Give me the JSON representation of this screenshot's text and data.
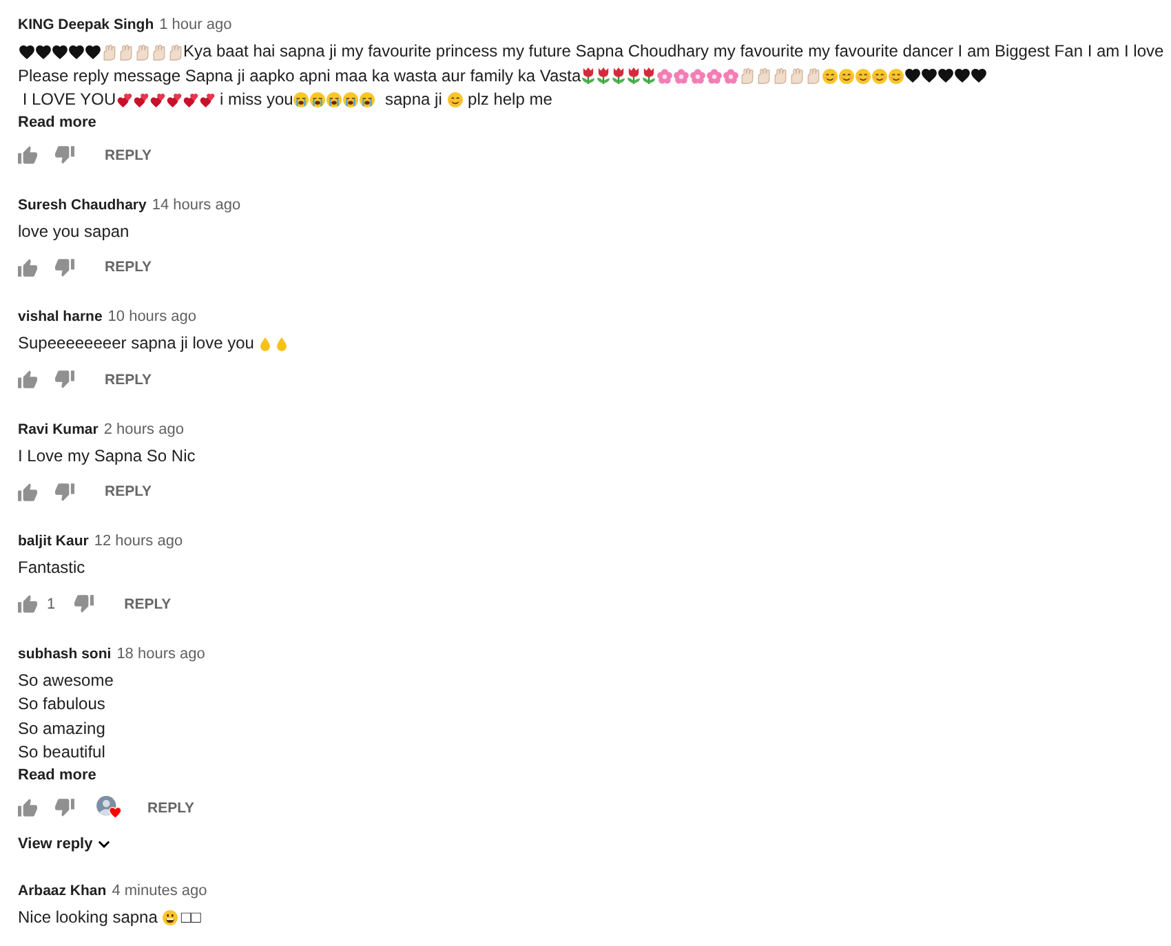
{
  "comments": [
    {
      "author": "KING Deepak Singh",
      "time": "1 hour ago",
      "lines": [
        [
          {
            "kind": "heart"
          },
          {
            "kind": "heart"
          },
          {
            "kind": "heart"
          },
          {
            "kind": "heart"
          },
          {
            "kind": "heart"
          },
          {
            "kind": "hand"
          },
          {
            "kind": "hand"
          },
          {
            "kind": "hand"
          },
          {
            "kind": "hand"
          },
          {
            "kind": "hand"
          },
          {
            "kind": "text",
            "text": "Kya baat hai sapna ji my favourite princess my future Sapna Choudhary my favourite my favourite dancer I am Biggest Fan I am I love"
          }
        ],
        [
          {
            "kind": "text",
            "text": "Please reply message Sapna ji aapko apni maa ka wasta aur family ka Vasta"
          },
          {
            "kind": "tulip"
          },
          {
            "kind": "tulip"
          },
          {
            "kind": "tulip"
          },
          {
            "kind": "tulip"
          },
          {
            "kind": "tulip"
          },
          {
            "kind": "blossom"
          },
          {
            "kind": "blossom"
          },
          {
            "kind": "blossom"
          },
          {
            "kind": "blossom"
          },
          {
            "kind": "blossom"
          },
          {
            "kind": "hand"
          },
          {
            "kind": "hand"
          },
          {
            "kind": "hand"
          },
          {
            "kind": "hand"
          },
          {
            "kind": "hand"
          },
          {
            "kind": "smiley"
          },
          {
            "kind": "smiley"
          },
          {
            "kind": "smiley"
          },
          {
            "kind": "smiley"
          },
          {
            "kind": "smiley"
          },
          {
            "kind": "heart"
          },
          {
            "kind": "heart"
          },
          {
            "kind": "heart"
          },
          {
            "kind": "heart"
          },
          {
            "kind": "heart"
          }
        ],
        [
          {
            "kind": "text",
            "text": " I LOVE YOU"
          },
          {
            "kind": "twohearts"
          },
          {
            "kind": "twohearts"
          },
          {
            "kind": "twohearts"
          },
          {
            "kind": "twohearts"
          },
          {
            "kind": "twohearts"
          },
          {
            "kind": "twohearts"
          },
          {
            "kind": "text",
            "text": " i miss you"
          },
          {
            "kind": "crying"
          },
          {
            "kind": "crying"
          },
          {
            "kind": "crying"
          },
          {
            "kind": "crying"
          },
          {
            "kind": "crying"
          },
          {
            "kind": "text",
            "text": "  sapna ji "
          },
          {
            "kind": "smiley"
          },
          {
            "kind": "text",
            "text": " plz help me"
          }
        ]
      ],
      "read_more": "Read more",
      "hearted": false,
      "reply": "REPLY"
    },
    {
      "author": "Suresh Chaudhary",
      "time": "14 hours ago",
      "lines": [
        [
          {
            "kind": "text",
            "text": "love you sapan"
          }
        ]
      ],
      "hearted": false,
      "reply": "REPLY"
    },
    {
      "author": "vishal harne",
      "time": "10 hours ago",
      "lines": [
        [
          {
            "kind": "text",
            "text": "Supeeeeeeeer sapna ji love you"
          },
          {
            "kind": "drop"
          },
          {
            "kind": "drop"
          }
        ]
      ],
      "hearted": false,
      "reply": "REPLY"
    },
    {
      "author": "Ravi Kumar",
      "time": "2 hours ago",
      "lines": [
        [
          {
            "kind": "text",
            "text": "I Love my Sapna So Nic"
          }
        ]
      ],
      "hearted": false,
      "reply": "REPLY"
    },
    {
      "author": "baljit Kaur",
      "time": "12 hours ago",
      "lines": [
        [
          {
            "kind": "text",
            "text": "Fantastic"
          }
        ]
      ],
      "likes": "1",
      "hearted": false,
      "reply": "REPLY"
    },
    {
      "author": "subhash soni",
      "time": "18 hours ago",
      "lines": [
        [
          {
            "kind": "text",
            "text": "So awesome"
          }
        ],
        [
          {
            "kind": "text",
            "text": "So fabulous"
          }
        ],
        [
          {
            "kind": "text",
            "text": "So amazing"
          }
        ],
        [
          {
            "kind": "text",
            "text": "So beautiful"
          }
        ]
      ],
      "read_more": "Read more",
      "hearted": true,
      "reply": "REPLY",
      "replies": {
        "label": "View reply",
        "expanded": false
      }
    },
    {
      "author": "Arbaaz Khan",
      "time": "4 minutes ago",
      "lines": [
        [
          {
            "kind": "text",
            "text": "Nice looking sapna"
          },
          {
            "kind": "grin"
          },
          {
            "kind": "text",
            "text": "□□"
          }
        ]
      ]
    }
  ]
}
